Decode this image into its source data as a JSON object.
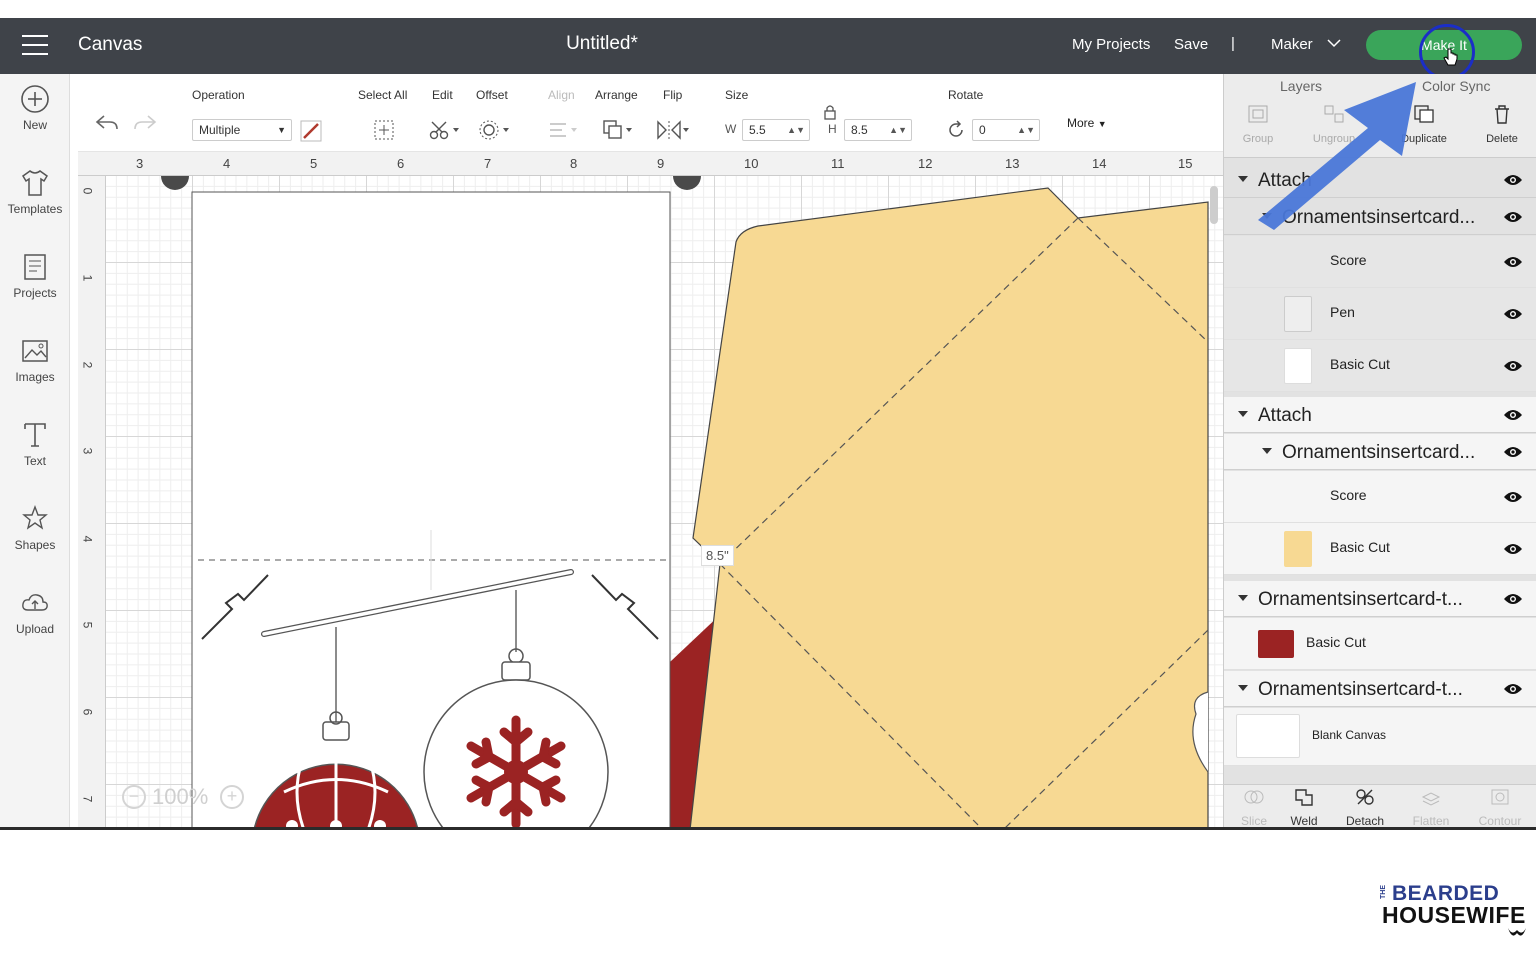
{
  "header": {
    "app_title": "Canvas",
    "doc_title": "Untitled*",
    "my_projects": "My Projects",
    "save": "Save",
    "separator": "|",
    "machine": "Maker",
    "make_it": "Make It"
  },
  "sidebar": {
    "items": [
      {
        "label": "New",
        "icon": "plus-circle-icon"
      },
      {
        "label": "Templates",
        "icon": "shirt-icon"
      },
      {
        "label": "Projects",
        "icon": "projects-icon"
      },
      {
        "label": "Images",
        "icon": "image-icon"
      },
      {
        "label": "Text",
        "icon": "text-icon"
      },
      {
        "label": "Shapes",
        "icon": "shapes-icon"
      },
      {
        "label": "Upload",
        "icon": "upload-icon"
      }
    ]
  },
  "toolbar": {
    "operation_label": "Operation",
    "operation_value": "Multiple",
    "select_all": "Select All",
    "edit": "Edit",
    "offset": "Offset",
    "align": "Align",
    "arrange": "Arrange",
    "flip": "Flip",
    "size": "Size",
    "w_label": "W",
    "w_value": "5.5",
    "h_label": "H",
    "h_value": "8.5",
    "rotate": "Rotate",
    "rotate_value": "0",
    "more": "More"
  },
  "canvas": {
    "ruler_top": [
      "3",
      "4",
      "5",
      "6",
      "7",
      "8",
      "9",
      "10",
      "11",
      "12",
      "13",
      "14",
      "15"
    ],
    "ruler_left": [
      "0",
      "1",
      "2",
      "3",
      "4",
      "5",
      "6",
      "7"
    ],
    "dimension_label": "8.5\"",
    "zoom": "100%",
    "zoom_minus": "−",
    "zoom_plus": "+"
  },
  "layers": {
    "tab_layers": "Layers",
    "tab_color_sync": "Color Sync",
    "actions": [
      "Group",
      "Ungroup",
      "Duplicate",
      "Delete"
    ],
    "groups": [
      {
        "name": "Attach",
        "child": "Ornamentsinsertcard...",
        "layers": [
          "Score",
          "Pen",
          "Basic Cut"
        ]
      },
      {
        "name": "Attach",
        "child": "Ornamentsinsertcard...",
        "layers": [
          "Score",
          "Basic Cut"
        ]
      },
      {
        "name": "Ornamentsinsertcard-t...",
        "layers": [
          "Basic Cut"
        ]
      },
      {
        "name": "Ornamentsinsertcard-t...",
        "layers": [
          "Blank Canvas"
        ]
      }
    ],
    "bottom_actions": [
      "Slice",
      "Weld",
      "Detach",
      "Flatten",
      "Contour"
    ]
  },
  "colors": {
    "header_bg": "#3f4349",
    "make_it_green": "#3aa55a",
    "envelope_yellow": "#f7d993",
    "ornament_red": "#9b2323",
    "arrow_blue": "#4a77d8",
    "ring_blue": "#1b2ec7"
  },
  "watermark": {
    "line0": "THE",
    "line1": "BEARDED",
    "line2": "HOUSEWIFE"
  }
}
